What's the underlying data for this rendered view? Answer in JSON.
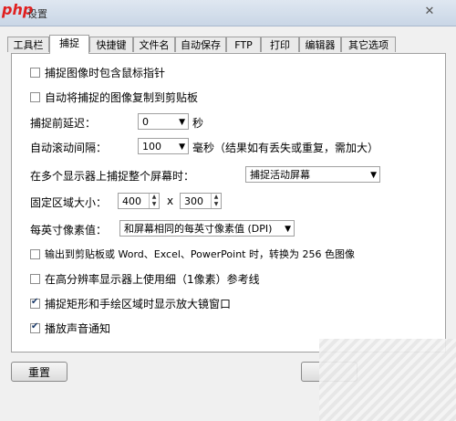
{
  "window": {
    "logo": "php",
    "logo_sub": "设置",
    "close": "✕"
  },
  "tabs": [
    {
      "label": "工具栏"
    },
    {
      "label": "捕捉"
    },
    {
      "label": "快捷键"
    },
    {
      "label": "文件名"
    },
    {
      "label": "自动保存"
    },
    {
      "label": "FTP"
    },
    {
      "label": "打印"
    },
    {
      "label": "编辑器"
    },
    {
      "label": "其它选项"
    }
  ],
  "active_tab": "捕捉",
  "options": {
    "include_cursor": {
      "label": "捕捉图像时包含鼠标指针",
      "checked": false
    },
    "copy_clipboard": {
      "label": "自动将捕捉的图像复制到剪贴板",
      "checked": false
    },
    "delay": {
      "label": "捕捉前延迟：",
      "value": "0",
      "unit": "秒"
    },
    "scroll": {
      "label": "自动滚动间隔：",
      "value": "100",
      "unit": "毫秒（结果如有丢失或重复，需加大）"
    },
    "multi_monitor": {
      "label": "在多个显示器上捕捉整个屏幕时：",
      "value": "捕捉活动屏幕"
    },
    "fixed_region": {
      "label": "固定区域大小：",
      "width": "400",
      "x": "x",
      "height": "300"
    },
    "dpi": {
      "label": "每英寸像素值：",
      "value": "和屏幕相同的每英寸像素值 (DPI)"
    },
    "convert_256": {
      "label": "输出到剪贴板或 Word、Excel、PowerPoint 时，转换为 256 色图像",
      "checked": false
    },
    "thin_lines": {
      "label": "在高分辨率显示器上使用细（1像素）参考线",
      "checked": false
    },
    "magnifier": {
      "label": "捕捉矩形和手绘区域时显示放大镜窗口",
      "checked": true
    },
    "sound": {
      "label": "播放声音通知",
      "checked": true
    }
  },
  "buttons": {
    "reset": "重置"
  },
  "colors": {
    "accent": "#1a3a6a",
    "panel_bg": "#ffffff",
    "window_bg": "#f0f0f0"
  }
}
